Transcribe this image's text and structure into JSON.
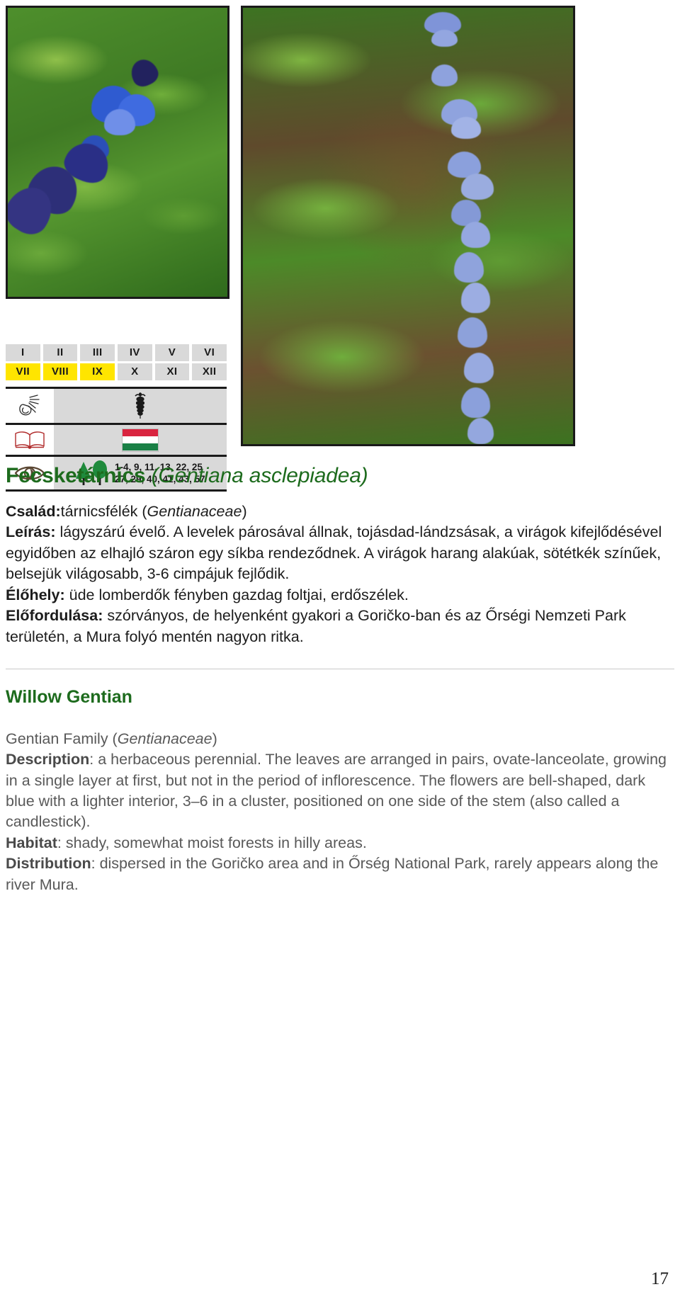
{
  "photos": [
    {
      "caption_alt": "Gentiana asclepiadea close-up of dark blue bell flowers among lanceolate green leaves"
    },
    {
      "caption_alt": "Gentiana asclepiadea full stem with pale blue bell flowers arranged on one side"
    }
  ],
  "symbol_table": {
    "months": [
      {
        "label": "I",
        "active": false
      },
      {
        "label": "II",
        "active": false
      },
      {
        "label": "III",
        "active": false
      },
      {
        "label": "IV",
        "active": false
      },
      {
        "label": "V",
        "active": false
      },
      {
        "label": "VI",
        "active": false
      },
      {
        "label": "VII",
        "active": true
      },
      {
        "label": "VIII",
        "active": true
      },
      {
        "label": "IX",
        "active": true
      },
      {
        "label": "X",
        "active": false
      },
      {
        "label": "XI",
        "active": false
      },
      {
        "label": "XII",
        "active": false
      }
    ],
    "rows": [
      {
        "left_icon": "ok-hand-icon",
        "right_icon": "caduceus-icon",
        "value": ""
      },
      {
        "left_icon": "open-book-icon",
        "right_icon": "hungarian-flag-icon",
        "value": ""
      },
      {
        "left_icon": "eye-icon",
        "right_icon": "forest-trees-icon",
        "value_line1": "1-4, 9, 11, 13, 22, 25",
        "value_line2": "27, 29, 40, 41, 43, 57"
      }
    ]
  },
  "hungarian": {
    "common_name": "Fecsketárnics",
    "latin_name": "(Gentiana asclepiadea)",
    "family_label": "Család:",
    "family_value": "tárnicsfélék (",
    "family_latin": "Gentianaceae",
    "family_close": ")",
    "description_label": "Leírás:",
    "description_text": " lágyszárú évelő. A levelek párosával állnak, tojásdad-lándzsásak, a virágok kifejlődésével egyidőben az elhajló száron egy síkba rendeződnek. A virágok harang alakúak, sötétkék színűek, belsejük világosabb, 3-6 cimpájuk fejlődik.",
    "habitat_label": "Élőhely:",
    "habitat_text": " üde lomberdők fényben gazdag foltjai, erdőszélek.",
    "distribution_label": "Előfordulása:",
    "distribution_text": " szórványos, de helyenként gyakori a Goričko-ban és az Őrségi Nemzeti Park területén, a Mura folyó mentén nagyon ritka."
  },
  "english": {
    "common_name": "Willow Gentian",
    "family_text": "Gentian Family (",
    "family_latin": "Gentianaceae",
    "family_close": ")",
    "description_label": "Description",
    "description_text": ": a herbaceous perennial. The leaves are arranged in pairs, ovate-lanceolate, growing in a single layer at first, but not in the period of inflorescence. The flowers are bell-shaped, dark blue with a lighter interior, 3–6 in a cluster, positioned on one side of the stem (also called a candlestick).",
    "habitat_label": "Habitat",
    "habitat_text": ": shady, somewhat moist forests in hilly areas.",
    "distribution_label": "Distribution",
    "distribution_text": ": dispersed in the Goričko area and in Őrség National Park, rarely appears along the river Mura."
  },
  "page_number": "17",
  "colors": {
    "heading_green": "#1d6b1d",
    "month_active": "#ffe500",
    "month_inactive": "#d9d9d9",
    "table_cell_bg": "#d9d9d9",
    "en_body_gray": "#595959",
    "flag_red": "#d9243f",
    "flag_green": "#1a8046",
    "tree_green": "#1f8a3c",
    "book_red": "#b02b2b",
    "eye_brown": "#5a4632"
  }
}
